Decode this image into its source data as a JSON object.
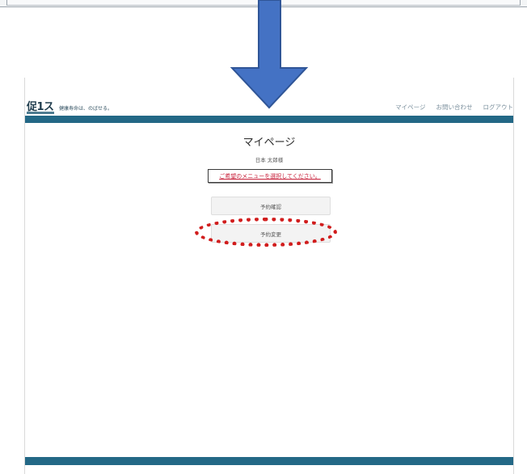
{
  "header": {
    "logo_text": "促1ス",
    "tagline": "健康寿命は、のばせる。",
    "nav": [
      "マイページ",
      "お問い合わせ",
      "ログアウト"
    ]
  },
  "main": {
    "title": "マイページ",
    "username": "日本 太郎様",
    "prompt": "ご希望のメニューを選択してください。",
    "buttons": [
      "予約確認",
      "予約変更"
    ]
  },
  "colors": {
    "brand_bar": "#236886",
    "arrow": "#4472c4",
    "highlight": "#d11d1d",
    "prompt_text": "#c8203a"
  }
}
